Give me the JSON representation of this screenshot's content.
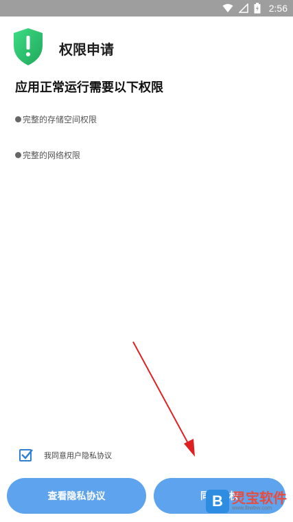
{
  "status_bar": {
    "time": "2:56",
    "icons": [
      "wifi-icon",
      "signal-icon",
      "battery-icon"
    ]
  },
  "header": {
    "title": "权限申请",
    "icon": "shield-exclamation-icon",
    "icon_color": "#2ecc71"
  },
  "subtitle": "应用正常运行需要以下权限",
  "permissions": [
    {
      "label": "完整的存储空间权限"
    },
    {
      "label": "完整的网络权限"
    }
  ],
  "agreement": {
    "checked": true,
    "label": "我同意用户隐私协议"
  },
  "buttons": {
    "view_privacy": "查看隐私协议",
    "agree_label": "同意授权"
  },
  "watermark": {
    "name": "灵宝软件",
    "url": "www.lbwbw.com",
    "logo_letter": "B"
  },
  "colors": {
    "accent": "#5ea3ee",
    "status_bar": "#9e9e9e",
    "arrow": "#e02020"
  }
}
